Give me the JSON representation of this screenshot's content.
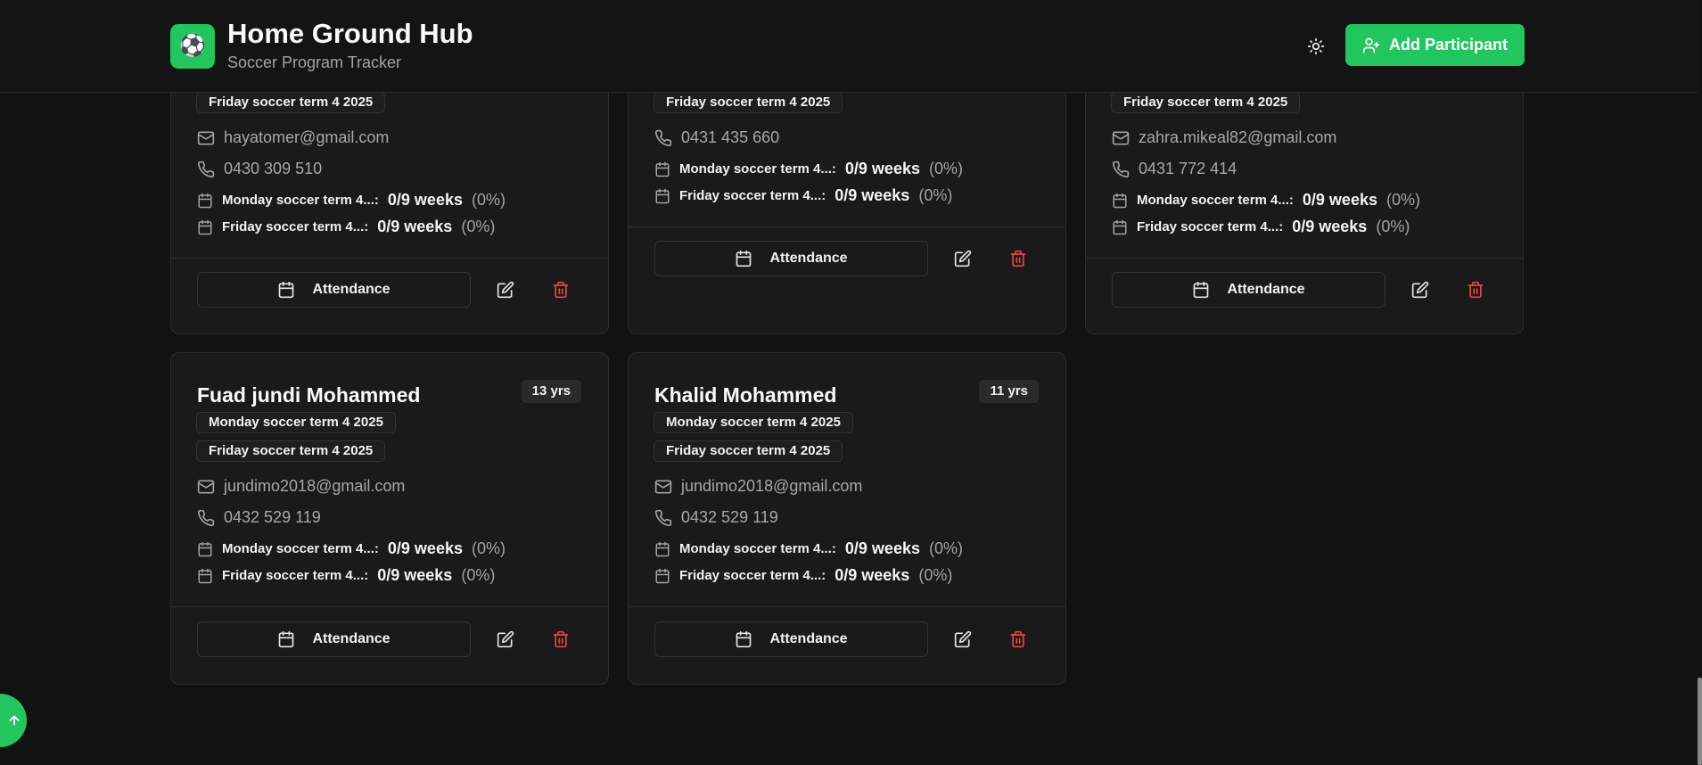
{
  "header": {
    "logo_emoji": "⚽",
    "title": "Home Ground Hub",
    "subtitle": "Soccer Program Tracker",
    "add_button_label": "Add Participant",
    "accent_color": "#22c55e"
  },
  "cards": [
    {
      "tags": [
        "Friday soccer term 4 2025"
      ],
      "email": "hayatomer@gmail.com",
      "phone": "0430 309 510",
      "stats": [
        {
          "label": "Monday soccer term 4...:",
          "value": "0/9 weeks",
          "pct": "(0%)"
        },
        {
          "label": "Friday soccer term 4...:",
          "value": "0/9 weeks",
          "pct": "(0%)"
        }
      ],
      "attendance_label": "Attendance"
    },
    {
      "tags": [
        "Friday soccer term 4 2025"
      ],
      "phone": "0431 435 660",
      "stats": [
        {
          "label": "Monday soccer term 4...:",
          "value": "0/9 weeks",
          "pct": "(0%)"
        },
        {
          "label": "Friday soccer term 4...:",
          "value": "0/9 weeks",
          "pct": "(0%)"
        }
      ],
      "attendance_label": "Attendance"
    },
    {
      "tags": [
        "Friday soccer term 4 2025"
      ],
      "email": "zahra.mikeal82@gmail.com",
      "phone": "0431 772 414",
      "stats": [
        {
          "label": "Monday soccer term 4...:",
          "value": "0/9 weeks",
          "pct": "(0%)"
        },
        {
          "label": "Friday soccer term 4...:",
          "value": "0/9 weeks",
          "pct": "(0%)"
        }
      ],
      "attendance_label": "Attendance"
    },
    {
      "name": "Fuad jundi Mohammed",
      "age": "13 yrs",
      "tags": [
        "Monday soccer term 4 2025",
        "Friday soccer term 4 2025"
      ],
      "email": "jundimo2018@gmail.com",
      "phone": "0432 529 119",
      "stats": [
        {
          "label": "Monday soccer term 4...:",
          "value": "0/9 weeks",
          "pct": "(0%)"
        },
        {
          "label": "Friday soccer term 4...:",
          "value": "0/9 weeks",
          "pct": "(0%)"
        }
      ],
      "attendance_label": "Attendance"
    },
    {
      "name": "Khalid Mohammed",
      "age": "11 yrs",
      "tags": [
        "Monday soccer term 4 2025",
        "Friday soccer term 4 2025"
      ],
      "email": "jundimo2018@gmail.com",
      "phone": "0432 529 119",
      "stats": [
        {
          "label": "Monday soccer term 4...:",
          "value": "0/9 weeks",
          "pct": "(0%)"
        },
        {
          "label": "Friday soccer term 4...:",
          "value": "0/9 weeks",
          "pct": "(0%)"
        }
      ],
      "attendance_label": "Attendance"
    }
  ],
  "fab": {
    "icon": "arrow-up-icon"
  }
}
